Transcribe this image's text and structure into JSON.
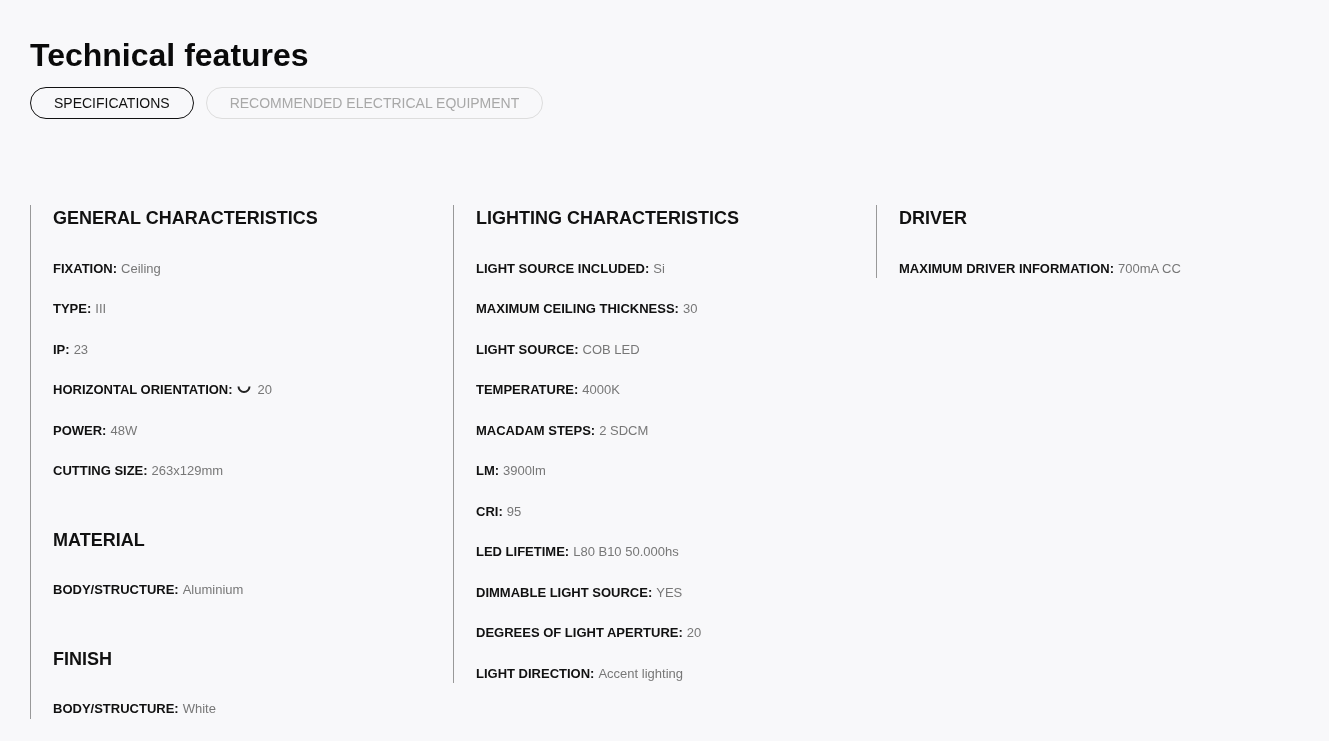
{
  "title": "Technical features",
  "tabs": [
    {
      "label": "SPECIFICATIONS",
      "selected": true
    },
    {
      "label": "RECOMMENDED ELECTRICAL EQUIPMENT",
      "selected": false
    }
  ],
  "columns": [
    {
      "sections": [
        {
          "heading": "GENERAL CHARACTERISTICS",
          "items": [
            {
              "kind": "text",
              "label": "FIXATION:",
              "value": "Ceiling"
            },
            {
              "kind": "text",
              "label": "TYPE:",
              "value": "III"
            },
            {
              "kind": "text",
              "label": "IP:",
              "value": "23"
            },
            {
              "kind": "rotation",
              "label": "HORIZONTAL ORIENTATION:",
              "value": "20"
            },
            {
              "kind": "text",
              "label": "POWER:",
              "value": "48W"
            },
            {
              "kind": "text",
              "label": "CUTTING SIZE:",
              "value": "263x129mm"
            }
          ]
        },
        {
          "heading": "MATERIAL",
          "items": [
            {
              "kind": "text",
              "label": "BODY/STRUCTURE:",
              "value": "Aluminium"
            }
          ]
        },
        {
          "heading": "FINISH",
          "items": [
            {
              "kind": "text",
              "label": "BODY/STRUCTURE:",
              "value": "White"
            }
          ]
        }
      ]
    },
    {
      "sections": [
        {
          "heading": "LIGHTING CHARACTERISTICS",
          "items": [
            {
              "kind": "text",
              "label": "LIGHT SOURCE INCLUDED:",
              "value": "Si"
            },
            {
              "kind": "text",
              "label": "MAXIMUM CEILING THICKNESS:",
              "value": "30"
            },
            {
              "kind": "text",
              "label": "LIGHT SOURCE:",
              "value": "COB LED"
            },
            {
              "kind": "text",
              "label": "TEMPERATURE:",
              "value": "4000K"
            },
            {
              "kind": "text",
              "label": "MACADAM STEPS:",
              "value": "2 SDCM"
            },
            {
              "kind": "text",
              "label": "LM:",
              "value": "3900lm"
            },
            {
              "kind": "text",
              "label": "CRI:",
              "value": "95"
            },
            {
              "kind": "text",
              "label": "LED LIFETIME:",
              "value": "L80 B10 50.000hs"
            },
            {
              "kind": "text",
              "label": "DIMMABLE LIGHT SOURCE:",
              "value": "YES"
            },
            {
              "kind": "text",
              "label": "DEGREES OF LIGHT APERTURE:",
              "value": "20"
            },
            {
              "kind": "text",
              "label": "LIGHT DIRECTION:",
              "value": "Accent lighting"
            }
          ]
        }
      ]
    },
    {
      "sections": [
        {
          "heading": "DRIVER",
          "items": [
            {
              "kind": "text",
              "label": "MAXIMUM DRIVER INFORMATION:",
              "value": "700mA CC"
            }
          ]
        }
      ]
    }
  ]
}
